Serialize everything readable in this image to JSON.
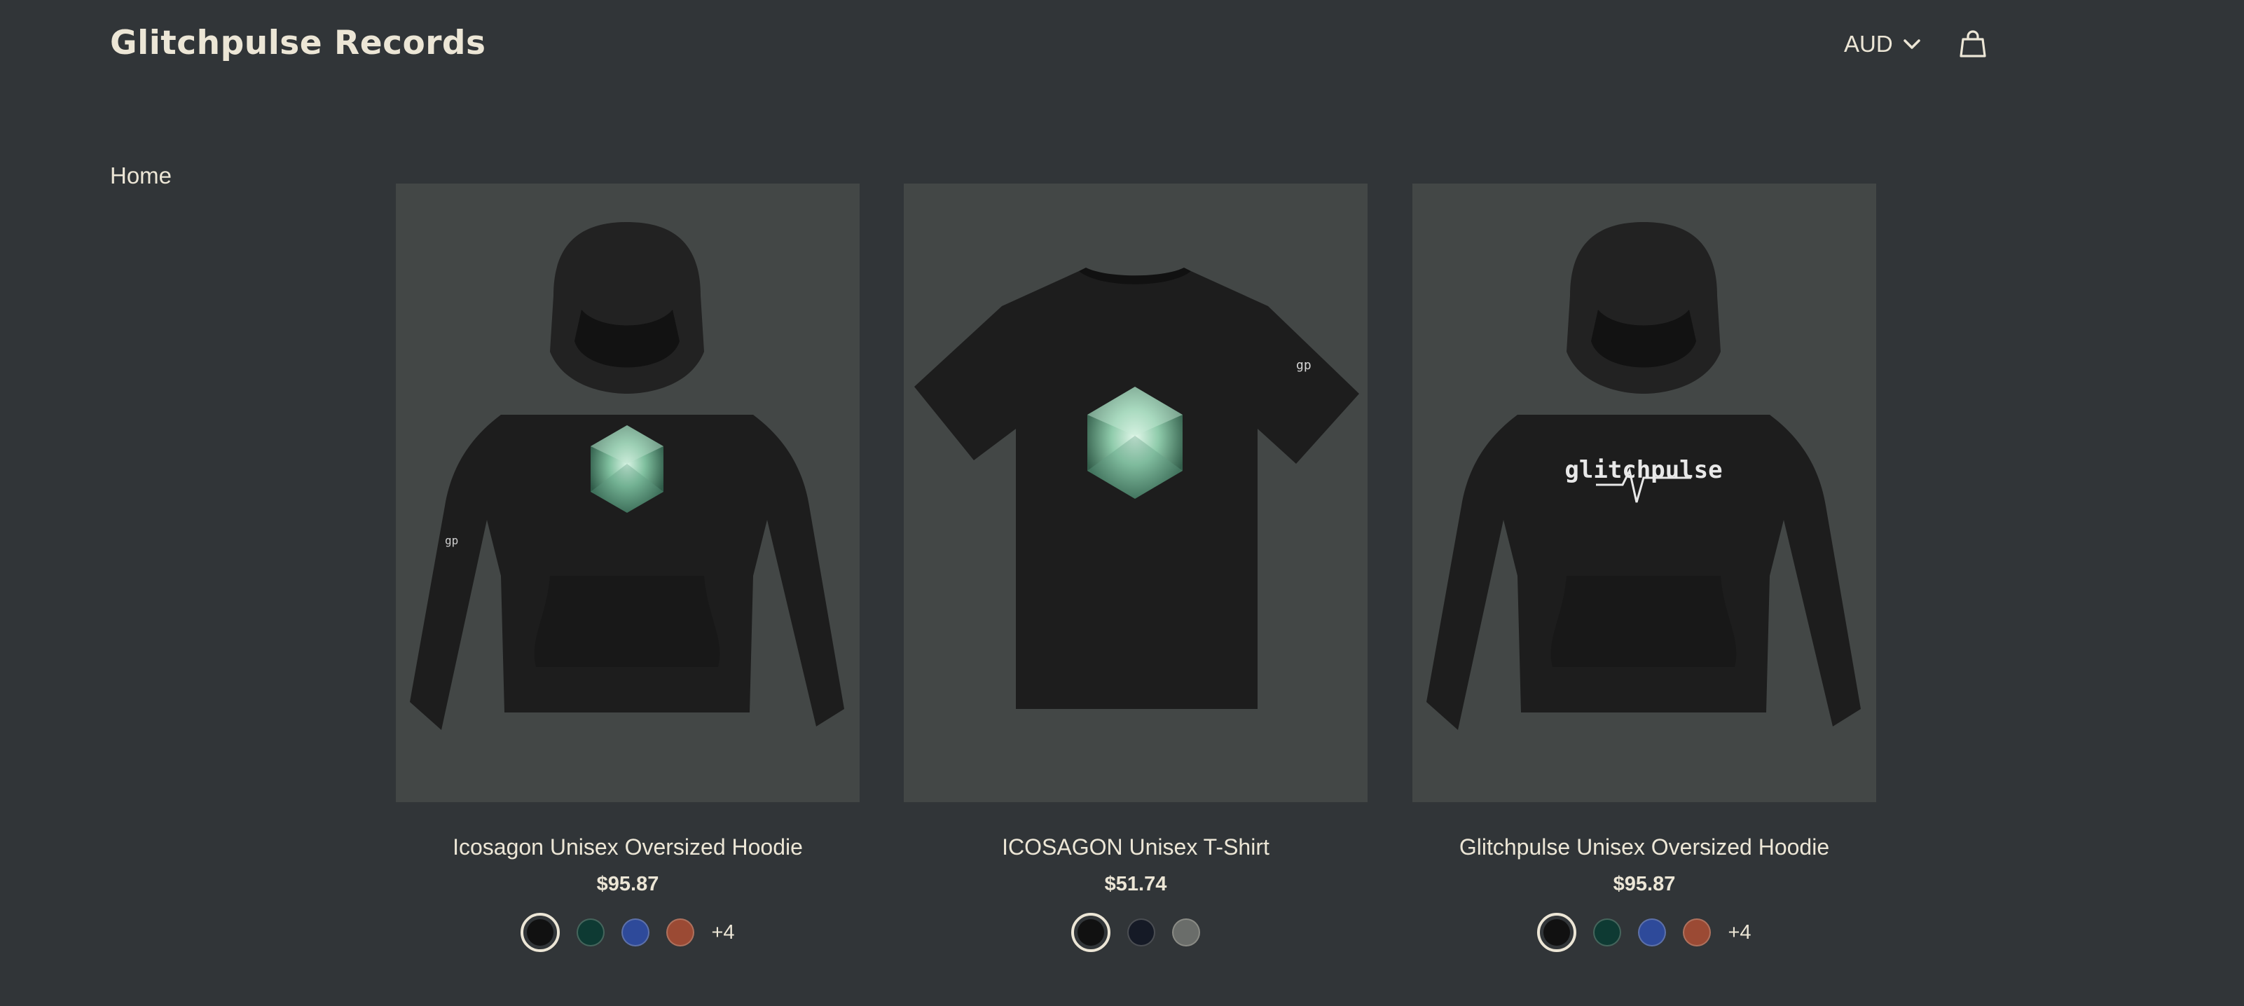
{
  "header": {
    "brand": "Glitchpulse Records",
    "currency": "AUD"
  },
  "breadcrumb": {
    "home": "Home"
  },
  "products": [
    {
      "title": "Icosagon Unisex Oversized Hoodie",
      "price": "$95.87",
      "swatches": [
        "#111111",
        "#0e3a33",
        "#2e4a9a",
        "#9b4a34"
      ],
      "more": "+4"
    },
    {
      "title": "ICOSAGON Unisex T-Shirt",
      "price": "$51.74",
      "swatches": [
        "#111111",
        "#151a26",
        "#6a6d6a"
      ],
      "more": ""
    },
    {
      "title": "Glitchpulse Unisex Oversized Hoodie",
      "price": "$95.87",
      "swatches": [
        "#111111",
        "#0e3a33",
        "#2e4a9a",
        "#9b4a34"
      ],
      "more": "+4",
      "print_text": "glitchpulse"
    }
  ],
  "colors": {
    "background": "#313538",
    "image_bg": "#434746",
    "text": "#ece6d6"
  }
}
